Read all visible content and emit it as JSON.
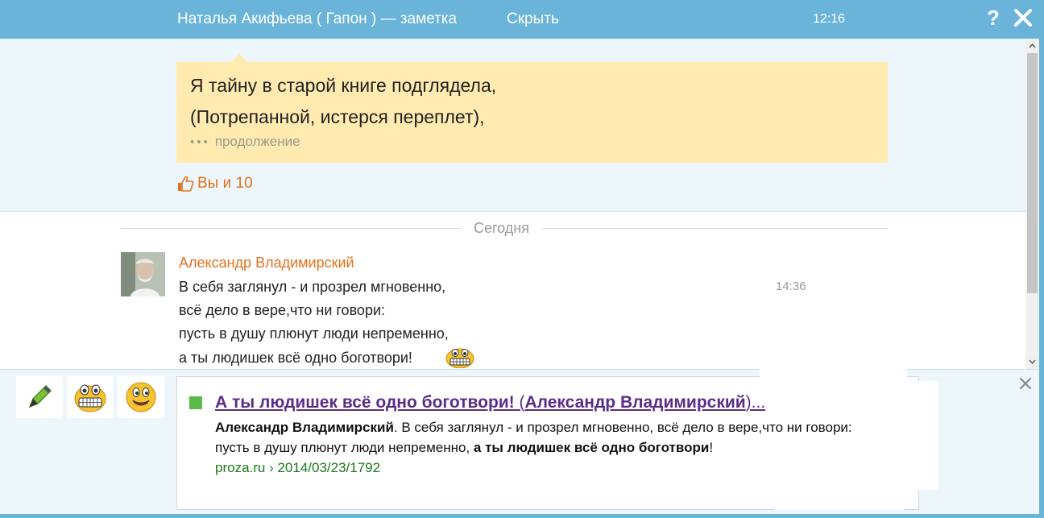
{
  "topbar": {
    "title": "Наталья Акифьева ( Гапон ) — заметка",
    "hide_label": "Скрыть",
    "time": "12:16",
    "help_label": "?"
  },
  "note": {
    "line1": "Я тайну в старой книге подглядела,",
    "line2": "(Потрепанной, истерся переплет),",
    "more_dots": "•••",
    "more_label": "продолжение",
    "likes_label": "Вы и 10"
  },
  "chat": {
    "day_label": "Сегодня",
    "message": {
      "author": "Александр Владимирский",
      "time": "14:36",
      "lines": [
        "В себя заглянул - и прозрел мгновенно,",
        "всё дело в вере,что ни говори:",
        "пусть в душу плюнут люди непременно,",
        "а ты людишек всё одно боготвори!"
      ]
    }
  },
  "suggestion": {
    "title_bold1": "А ты людишек всё одно боготвори!",
    "title_normal1": " (",
    "title_bold2": "Александр Владимирский",
    "title_normal2": ")...",
    "snippet_bold1": "Александр Владимирский",
    "snippet_text1": ". В себя заглянул - и прозрел мгновенно, всё дело в вере,что ни говори:",
    "snippet_text2": "пусть в душу плюнут люди непременно, ",
    "snippet_bold2": "а ты людишек всё одно боготвори",
    "snippet_text3": "!",
    "url": "proza.ru › 2014/03/23/1792"
  },
  "colors": {
    "accent": "#6bb4d9",
    "note_bg": "#ffeab0",
    "author": "#e2731e",
    "link_visited": "#5b2d87",
    "url_green": "#1a7a1a"
  },
  "icons": {
    "close": "close-icon",
    "help": "help-icon",
    "like": "thumbs-up-icon",
    "marker": "marker-icon",
    "grin": "grin-emoji-icon",
    "smile": "smile-emoji-icon"
  }
}
